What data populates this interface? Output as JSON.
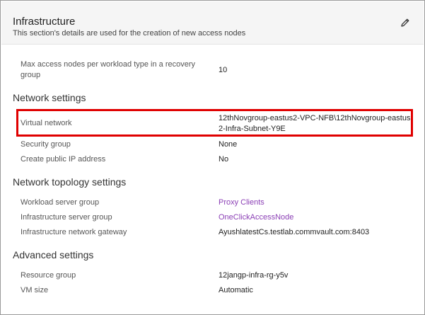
{
  "header": {
    "title": "Infrastructure",
    "subtitle": "This section's details are used for the creation of new access nodes",
    "edit_icon": "pencil-icon"
  },
  "general": {
    "max_access_nodes_label": "Max access nodes per workload type in a recovery group",
    "max_access_nodes_value": "10"
  },
  "network_settings": {
    "heading": "Network settings",
    "virtual_network_label": "Virtual network",
    "virtual_network_value": "12thNovgroup-eastus2-VPC-NFB\\12thNovgroup-eastus2-Infra-Subnet-Y9E",
    "security_group_label": "Security group",
    "security_group_value": "None",
    "public_ip_label": "Create public IP address",
    "public_ip_value": "No",
    "highlight_color": "#e00000"
  },
  "network_topology": {
    "heading": "Network topology settings",
    "workload_server_group_label": "Workload server group",
    "workload_server_group_value": "Proxy Clients",
    "infra_server_group_label": "Infrastructure server group",
    "infra_server_group_value": "OneClickAccessNode",
    "infra_gateway_label": "Infrastructure network gateway",
    "infra_gateway_value": "AyushlatestCs.testlab.commvault.com:8403",
    "link_color": "#8b3fb5"
  },
  "advanced": {
    "heading": "Advanced settings",
    "resource_group_label": "Resource group",
    "resource_group_value": "12jangp-infra-rg-y5v",
    "vm_size_label": "VM size",
    "vm_size_value": "Automatic"
  }
}
